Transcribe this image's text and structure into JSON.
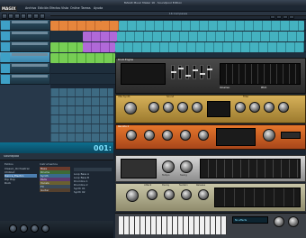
{
  "window": {
    "title": "MAGIX Music Maker 16 · Soundpool Edition"
  },
  "menu": [
    "Archivo",
    "Edición",
    "Efectos",
    "Vista",
    "Online",
    "Tareas",
    "Ayuda"
  ],
  "logo": "MAGIX",
  "arranger": {
    "ruler_label": "16 Compases",
    "counter": "001:"
  },
  "manager": {
    "tab": "Soundpool",
    "col_styles": "Estilos",
    "col_instr": "Instrumentos",
    "styles": [
      "Classic_Orchestral",
      "Chillout",
      "Dance_Electro",
      "Hip Hop",
      "Rock"
    ],
    "instruments": [
      "Bass",
      "Drums",
      "Synth",
      "Pads",
      "Vocals",
      "FX",
      "Guitar"
    ],
    "files": [
      "Loop Bass A",
      "Loop Bass B",
      "Drumline 1",
      "Drumline 2",
      "Synth 01",
      "Synth 02"
    ]
  },
  "rack": {
    "panel1": {
      "title": "Drum Engine",
      "labels": [
        "Volumen",
        "Pitch"
      ]
    },
    "panel2": {
      "title": "Vita Synth",
      "section_a": "Sound",
      "section_b": "Filter",
      "knob_labels": [
        "Cutoff",
        "Reso",
        "Attack",
        "Release",
        "Drive",
        "Mix",
        "Delay",
        "Reverb"
      ]
    },
    "panel3": {
      "title": "Revolta 2",
      "knob_labels": [
        "Osc 1",
        "Osc 2",
        "Env",
        "Filter",
        "LFO",
        "Volume"
      ]
    },
    "panel4": {
      "labels": [
        "Tempo",
        "Swing"
      ]
    },
    "panel5": {
      "labels": [
        "Attack",
        "Decay",
        "Sustain",
        "Release"
      ]
    },
    "status": "No effects"
  },
  "colors": {
    "accent": "#3ea0c6",
    "orange": "#f08a3c",
    "purple": "#b86ce0",
    "green": "#7bd655"
  }
}
